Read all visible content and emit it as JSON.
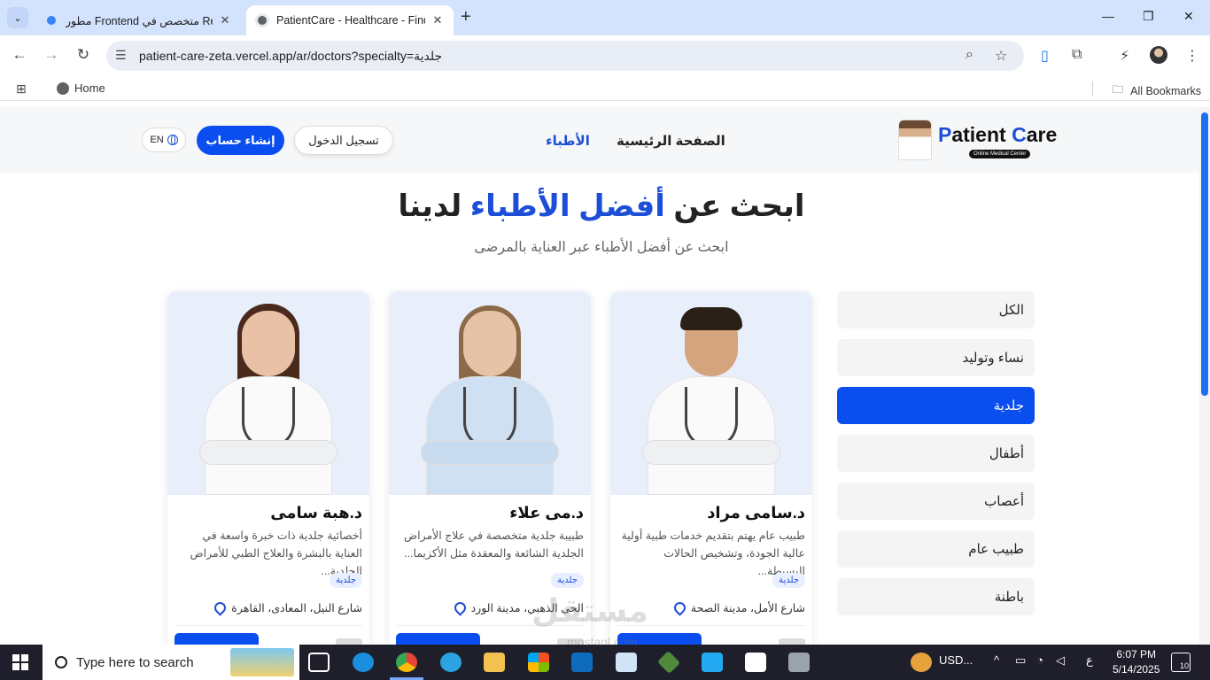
{
  "browser": {
    "tabs": [
      {
        "title": "مطور Frontend متخصص في React",
        "active": false
      },
      {
        "title": "PatientCare - Healthcare - Find",
        "active": true
      }
    ],
    "url": "patient-care-zeta.vercel.app/ar/doctors?specialty=جلدية",
    "bookmarks": {
      "home": "Home",
      "all": "All Bookmarks"
    }
  },
  "site": {
    "logo": {
      "text_p": "P",
      "text_atient": "atient ",
      "text_c": "C",
      "text_are": "are",
      "sub": "Online Medical Center"
    },
    "nav": {
      "home": "الصفحة الرئيسية",
      "doctors": "الأطباء"
    },
    "buttons": {
      "login": "تسجيل الدخول",
      "signup": "إنشاء حساب",
      "lang": "EN"
    },
    "hero": {
      "title_part1": "ابحث عن ",
      "title_accent": "أفضل الأطباء",
      "title_part2": " لدينا",
      "subtitle": "ابحث عن أفضل الأطباء عبر العناية بالمرضى"
    },
    "filters": [
      "الكل",
      "نساء وتوليد",
      "جلدية",
      "أطفال",
      "أعصاب",
      "طبيب عام",
      "باطنة"
    ],
    "active_filter": "جلدية",
    "doctors": [
      {
        "name": "د.سامى مراد",
        "desc": "طبيب عام يهتم بتقديم خدمات طبية أولية عالية الجودة، وتشخيص الحالات البسيطة...",
        "tag": "جلدية",
        "location": "شارع الأمل، مدينة الصحة"
      },
      {
        "name": "د.مى علاء",
        "desc": "طبيبة جلدية متخصصة في علاج الأمراض الجلدية الشائعة والمعقدة مثل الأكزيما...",
        "tag": "جلدية",
        "location": "الحى الذهبي، مدينة الورد"
      },
      {
        "name": "د.هبة سامى",
        "desc": "أخصائية جلدية ذات خبرة واسعة في العناية بالبشرة والعلاج الطبي للأمراض الجلدية...",
        "tag": "جلدية",
        "location": "شارع النيل، المعادى، القاهرة"
      }
    ],
    "watermark": {
      "main": "مستقل",
      "sub": "mostaql.com"
    }
  },
  "taskbar": {
    "search_placeholder": "Type here to search",
    "tray_label": "USD...",
    "lang": "ع",
    "time": "6:07 PM",
    "date": "5/14/2025",
    "notifications": "10"
  },
  "colors": {
    "accent": "#0a4ef0",
    "accent_text": "#1d4ed8",
    "tabbar": "#d3e3fd"
  }
}
